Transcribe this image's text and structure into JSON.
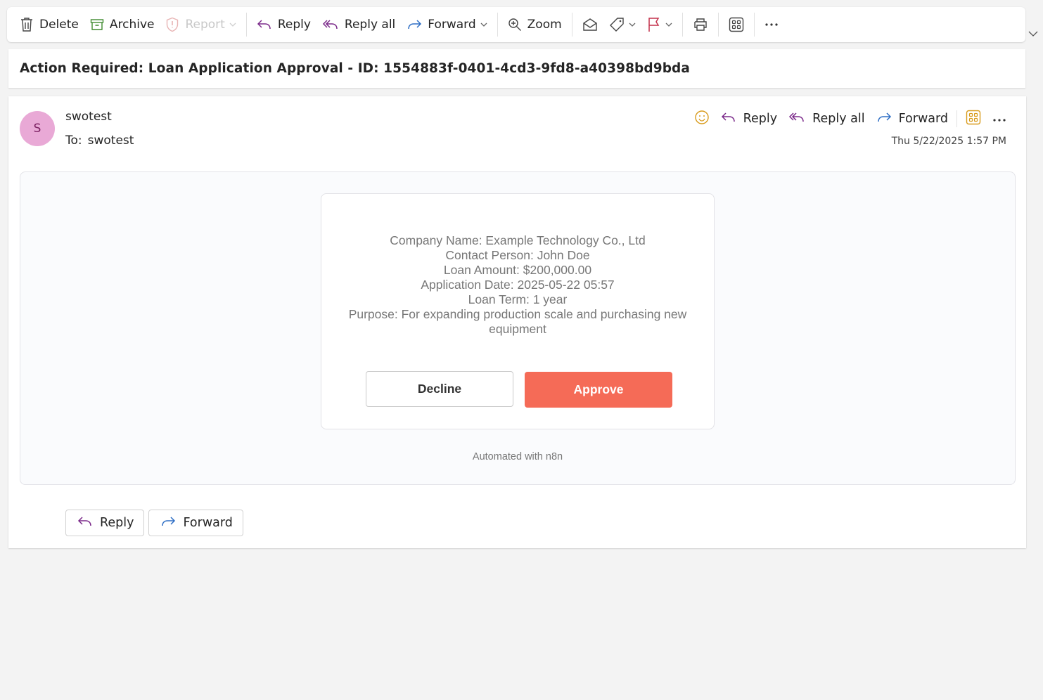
{
  "toolbar": {
    "delete": "Delete",
    "archive": "Archive",
    "report": "Report",
    "reply": "Reply",
    "reply_all": "Reply all",
    "forward": "Forward",
    "zoom": "Zoom"
  },
  "message": {
    "subject": "Action Required: Loan Application Approval - ID: 1554883f-0401-4cd3-9fd8-a40398bd9bda",
    "avatar_initial": "S",
    "sender": "swotest",
    "to_label": "To:",
    "to": "swotest",
    "timestamp": "Thu 5/22/2025 1:57 PM",
    "actions": {
      "reply": "Reply",
      "reply_all": "Reply all",
      "forward": "Forward"
    }
  },
  "body": {
    "lines": [
      "Company Name: Example Technology Co., Ltd",
      "Contact Person: John Doe",
      "Loan Amount: $200,000.00",
      "Application Date: 2025-05-22 05:57",
      "Loan Term: 1 year",
      "Purpose: For expanding production scale and purchasing new equipment"
    ],
    "decline_label": "Decline",
    "approve_label": "Approve",
    "footer": "Automated with n8n"
  },
  "bottom_actions": {
    "reply": "Reply",
    "forward": "Forward"
  },
  "colors": {
    "approve": "#f56b57",
    "avatar_bg": "#e9a9d6",
    "reply_icon": "#7b2a8a",
    "forward_icon": "#2f6fc5",
    "flag_icon": "#c4314b",
    "archive_icon": "#3f8a2f",
    "apps_icon": "#d89b1c"
  },
  "icons": [
    "delete-icon",
    "archive-icon",
    "report-icon",
    "reply-icon",
    "reply-all-icon",
    "forward-icon",
    "zoom-icon",
    "read-unread-icon",
    "tag-icon",
    "flag-icon",
    "print-icon",
    "apps-icon",
    "more-icon",
    "emoji-icon"
  ]
}
